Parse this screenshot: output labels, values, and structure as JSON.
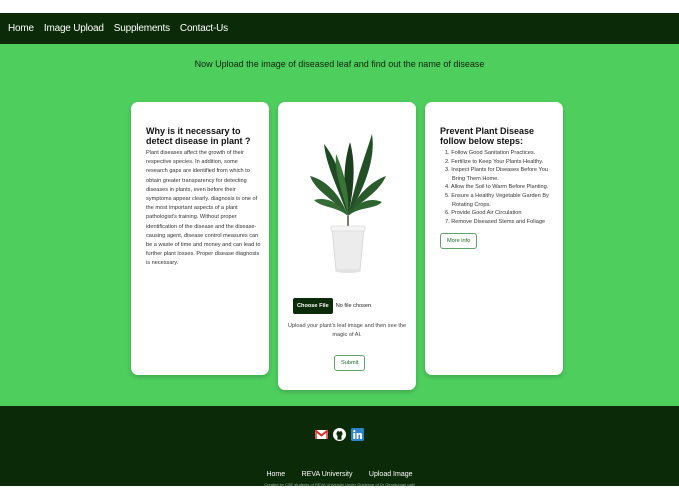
{
  "nav": {
    "items": [
      "Home",
      "Image Upload",
      "Supplements",
      "Contact-Us"
    ]
  },
  "main": {
    "headline": "Now Upload the image of diseased leaf and find out the name of disease"
  },
  "left_card": {
    "title": "Why is it necessary to detect disease in plant ?",
    "body": "Plant diseases affect the growth of their respective species. In addition, some research gaps are identified from which to obtain greater transparency for detecting diseases in plants, even before their symptoms appear clearly. diagnosis is one of the most important aspects of a plant pathologist's training. Without proper identification of the disease and the disease-causing agent, disease control measures can be a waste of time and money and can lead to further plant losses. Proper disease diagnosis is necessary."
  },
  "center_card": {
    "choose_file_label": "Choose File",
    "no_file_text": "No file chosen",
    "upload_hint": "Upload your plant's leaf image and then see the magic of AI.",
    "submit_label": "Submit"
  },
  "right_card": {
    "title": "Prevent Plant Disease follow below steps:",
    "steps": [
      "1. Follow Good Sanitation Practices.",
      "2. Fertilize to Keep Your Plants Healthy.",
      "3. Inspect Plants for Diseases Before You Bring Them Home.",
      "4. Allow the Soil to Warm Before Planting.",
      "5. Ensure a Healthy Vegetable Garden By Rotating Crops.",
      "6. Provide Good Air Circulation",
      "7. Remove Diseased Stems and Foliage"
    ],
    "more_info_label": "More info"
  },
  "footer": {
    "icons": [
      "gmail-icon",
      "github-icon",
      "linkedin-icon"
    ],
    "links": [
      "Home",
      "REVA University",
      "Upload Image"
    ],
    "credit": "Created by CSE students of REVA University Under Guidence of Dr Girardumari patil"
  },
  "colors": {
    "navbar": "#0b2a08",
    "main_bg": "#4ece5d",
    "card_bg": "#ffffff",
    "footer": "#0b2a08"
  }
}
